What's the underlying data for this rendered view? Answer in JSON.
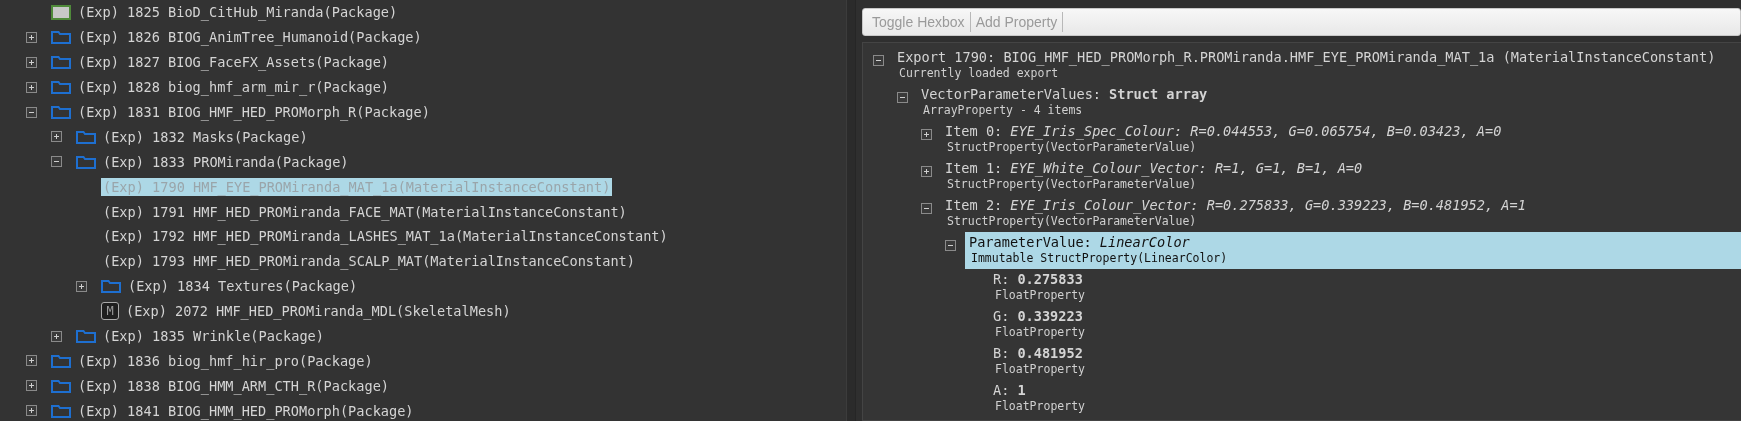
{
  "package_tree": [
    {
      "label": "(Exp) 1825 BioD_CitHub_Miranda(Package)",
      "kind": "package",
      "selected": false
    },
    {
      "label": "(Exp) 1826 BIOG_AnimTree_Humanoid(Package)",
      "kind": "folder",
      "expanded": false,
      "selected": false
    },
    {
      "label": "(Exp) 1827 BIOG_FaceFX_Assets(Package)",
      "kind": "folder",
      "expanded": false,
      "selected": false
    },
    {
      "label": "(Exp) 1828 biog_hmf_arm_mir_r(Package)",
      "kind": "folder",
      "expanded": false,
      "selected": false
    },
    {
      "label": "(Exp) 1831 BIOG_HMF_HED_PROMorph_R(Package)",
      "kind": "folder",
      "expanded": true,
      "selected": false,
      "children": [
        {
          "label": "(Exp) 1832 Masks(Package)",
          "kind": "folder",
          "expanded": false,
          "selected": false
        },
        {
          "label": "(Exp) 1833 PROMiranda(Package)",
          "kind": "folder",
          "expanded": true,
          "selected": false,
          "children": [
            {
              "label": "(Exp) 1790 HMF_EYE_PROMiranda_MAT_1a(MaterialInstanceConstant)",
              "kind": "material",
              "selected": true
            },
            {
              "label": "(Exp) 1791 HMF_HED_PROMiranda_FACE_MAT(MaterialInstanceConstant)",
              "kind": "material",
              "selected": false
            },
            {
              "label": "(Exp) 1792 HMF_HED_PROMiranda_LASHES_MAT_1a(MaterialInstanceConstant)",
              "kind": "material",
              "selected": false
            },
            {
              "label": "(Exp) 1793 HMF_HED_PROMiranda_SCALP_MAT(MaterialInstanceConstant)",
              "kind": "material",
              "selected": false
            },
            {
              "label": "(Exp) 1834 Textures(Package)",
              "kind": "folder",
              "expanded": false,
              "selected": false
            },
            {
              "label": "(Exp) 2072 HMF_HED_PROMiranda_MDL(SkeletalMesh)",
              "kind": "mesh",
              "icon_label": "M",
              "selected": false
            }
          ]
        },
        {
          "label": "(Exp) 1835 Wrinkle(Package)",
          "kind": "folder",
          "expanded": false,
          "selected": false
        }
      ]
    },
    {
      "label": "(Exp) 1836 biog_hmf_hir_pro(Package)",
      "kind": "folder",
      "expanded": false,
      "selected": false
    },
    {
      "label": "(Exp) 1838 BIOG_HMM_ARM_CTH_R(Package)",
      "kind": "folder",
      "expanded": false,
      "selected": false
    },
    {
      "label": "(Exp) 1841 BIOG_HMM_HED_PROMorph(Package)",
      "kind": "folder",
      "expanded": false,
      "selected": false
    }
  ],
  "toolbar": [
    {
      "label": "Toggle Hexbox"
    },
    {
      "label": "Add Property"
    }
  ],
  "properties": [
    {
      "label": "Export 1790: BIOG_HMF_HED_PROMorph_R.PROMiranda.HMF_EYE_PROMiranda_MAT_1a (MaterialInstanceConstant)",
      "type": "Currently loaded export",
      "expanded": true,
      "selected": false,
      "children": [
        {
          "label": "VectorParameterValues:",
          "value": "Struct array",
          "kind": "array",
          "type": "ArrayProperty - 4 items",
          "expanded": true,
          "selected": false,
          "children": [
            {
              "label": "Item 0:",
              "value": "EYE_Iris_Spec_Colour: R=0.044553, G=0.065754, B=0.03423, A=0",
              "kind": "struct",
              "type": "StructProperty(VectorParameterValue)",
              "expanded": false,
              "selected": false
            },
            {
              "label": "Item 1:",
              "value": "EYE_White_Colour_Vector: R=1, G=1, B=1, A=0",
              "kind": "struct",
              "type": "StructProperty(VectorParameterValue)",
              "expanded": false,
              "selected": false
            },
            {
              "label": "Item 2:",
              "value": "EYE_Iris_Colour_Vector: R=0.275833, G=0.339223, B=0.481952, A=1",
              "kind": "struct",
              "type": "StructProperty(VectorParameterValue)",
              "expanded": true,
              "selected": false,
              "children": [
                {
                  "label": "ParameterValue:",
                  "value": "LinearColor",
                  "kind": "struct",
                  "type": "Immutable StructProperty(LinearColor)",
                  "expanded": true,
                  "selected": true,
                  "children": [
                    {
                      "label": "R:",
                      "value": "0.275833",
                      "kind": "float",
                      "type": "FloatProperty",
                      "selected": false
                    },
                    {
                      "label": "G:",
                      "value": "0.339223",
                      "kind": "float",
                      "type": "FloatProperty",
                      "selected": false
                    },
                    {
                      "label": "B:",
                      "value": "0.481952",
                      "kind": "float",
                      "type": "FloatProperty",
                      "selected": false
                    },
                    {
                      "label": "A:",
                      "value": "1",
                      "kind": "float",
                      "type": "FloatProperty",
                      "selected": false
                    }
                  ]
                }
              ]
            }
          ]
        }
      ]
    }
  ]
}
